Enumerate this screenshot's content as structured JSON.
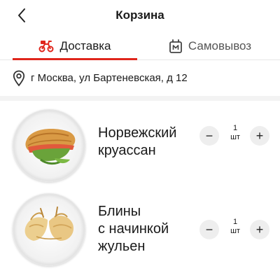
{
  "header": {
    "title": "Корзина",
    "back_icon": "chevron-left-icon"
  },
  "tabs": [
    {
      "label": "Доставка",
      "icon": "scooter-icon",
      "active": true
    },
    {
      "label": "Самовывоз",
      "icon": "bag-icon",
      "active": false
    }
  ],
  "address": {
    "icon": "location-pin-icon",
    "text": "г Москва, ул Бартеневская, д 12"
  },
  "items": [
    {
      "name_line1": "Норвежский",
      "name_line2": "круассан",
      "image_icon": "croissant-plate-icon",
      "quantity": "1",
      "unit": "шт",
      "minus_label": "−",
      "plus_label": "+"
    },
    {
      "name_line1": "Блины",
      "name_line2": "с начинкой",
      "name_line3": "жульен",
      "image_icon": "crepes-plate-icon",
      "quantity": "1",
      "unit": "шт",
      "minus_label": "−",
      "plus_label": "+"
    }
  ],
  "colors": {
    "accent": "#e0261c",
    "divider": "#f3f3f3",
    "button_bg": "#eeeeee"
  }
}
